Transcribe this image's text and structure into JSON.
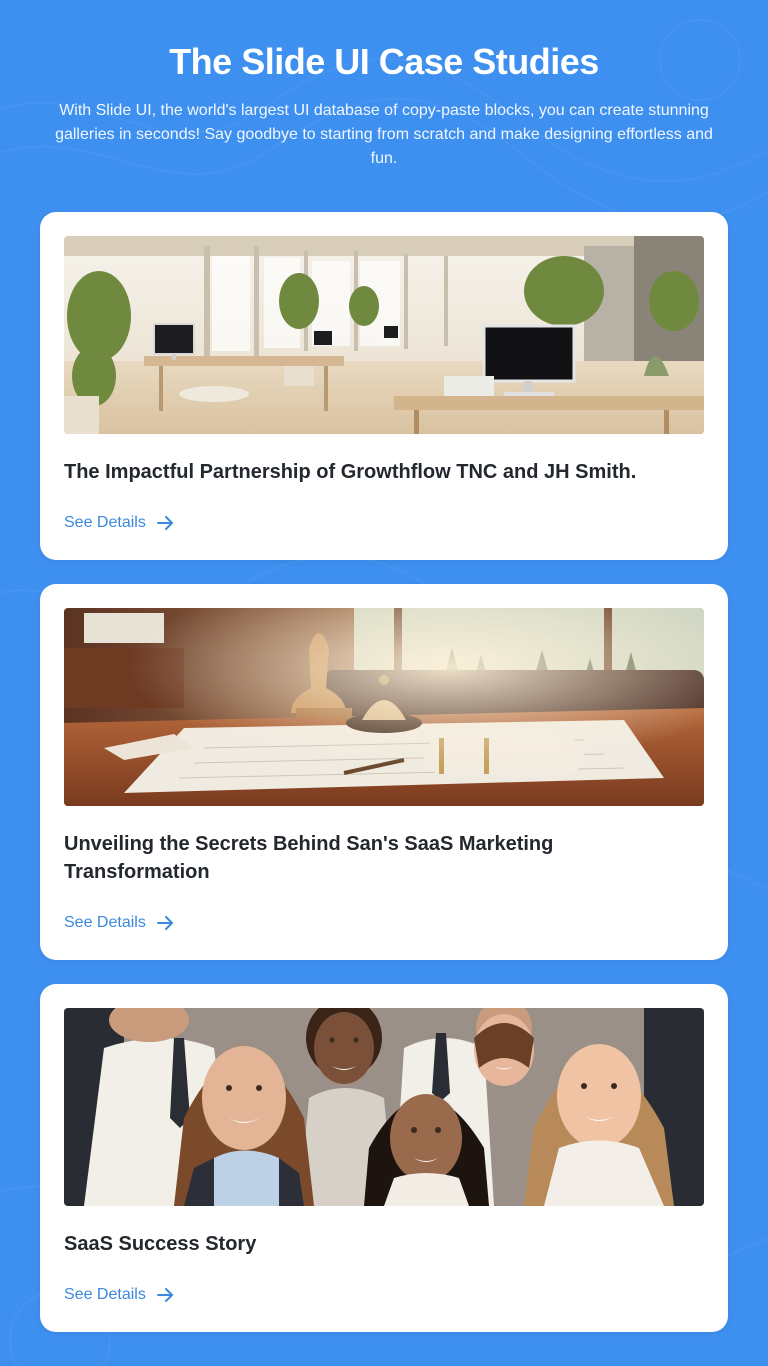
{
  "header": {
    "title": "The Slide UI Case Studies",
    "subtitle": "With Slide UI, the world's largest UI database of copy-paste blocks, you can create stunning galleries in seconds! Say goodbye to starting from scratch and make designing effortless and fun."
  },
  "cards": [
    {
      "title": "The Impactful Partnership of Growthflow TNC and JH Smith.",
      "link_label": "See Details",
      "image_icon": "office-photo"
    },
    {
      "title": "Unveiling the Secrets Behind San's SaaS Marketing Transformation",
      "link_label": "See Details",
      "image_icon": "desk-photo"
    },
    {
      "title": "SaaS Success Story",
      "link_label": "See Details",
      "image_icon": "team-photo"
    }
  ],
  "colors": {
    "background": "#3d8ff0",
    "card": "#ffffff",
    "title_text": "#23272e",
    "link": "#3b89dc"
  }
}
